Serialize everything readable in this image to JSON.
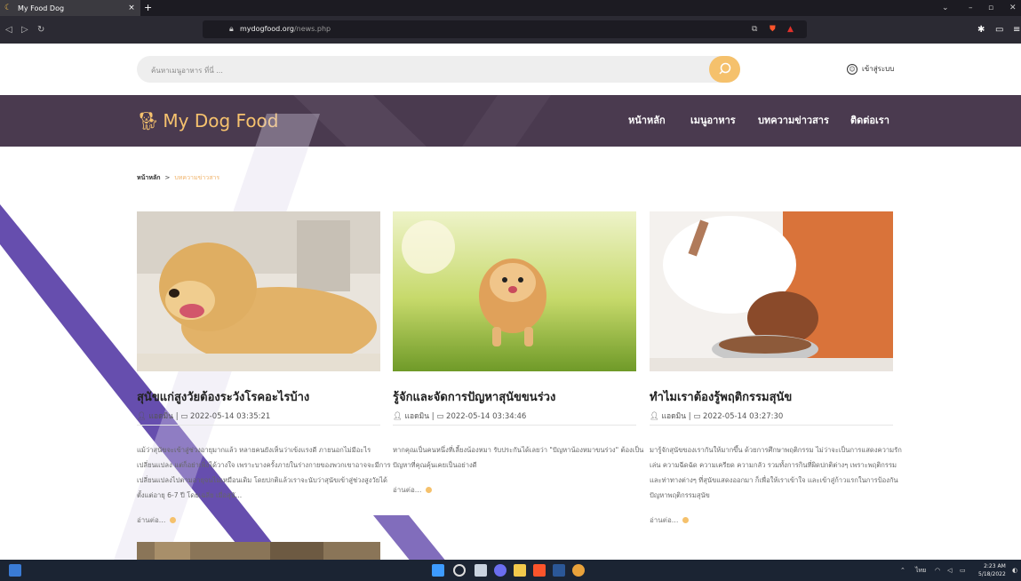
{
  "browser": {
    "tab_title": "My Food Dog",
    "tab_close": "×",
    "new_tab": "+",
    "url_domain": "mydogfood.org",
    "url_path": "/news.php"
  },
  "site": {
    "search_placeholder": "ค้นหาเมนูอาหาร ที่นี่ ...",
    "login_label": "เข้าสู่ระบบ",
    "logo_text": "My Dog Food",
    "nav": [
      "หน้าหลัก",
      "เมนูอาหาร",
      "บทความข่าวสาร",
      "ติดต่อเรา"
    ],
    "breadcrumb": {
      "home": "หน้าหลัก",
      "sep": ">",
      "current": "บทความข่าวสาร"
    },
    "read_more": "อ่านต่อ...",
    "articles": [
      {
        "title": "สุนัขแก่สูงวัยต้องระวังโรคอะไรบ้าง",
        "author": "แอดมิน",
        "date": "2022-05-14 03:35:21",
        "excerpt": "แม้ว่าสุนัขจะเข้าสู่ช่วงอายุมากแล้ว หลายคนยังเห็นว่าเข้งแรงดี ภายนอกไม่มีอะไรเปลี่ยนแปลง แต่ก็อย่าเพิ่งได้วางใจ เพราะบางครั้งภายในร่างกายของพวกเขาอาจจะมีการเปลี่ยนแปลงไปตามอายุจนไม่เหมือนเดิม โดยปกติแล้วเราจะนับว่าสุนัขเข้าสู่ช่วงสูงวัยได้ตั้งแต่อายุ 6-7 ปี โดยเฉลี่ย เมื่อสุนั..."
      },
      {
        "title": "รู้จักและจัดการปัญหาสุนัขขนร่วง",
        "author": "แอดมิน",
        "date": "2022-05-14 03:34:46",
        "excerpt": "หากคุณเป็นคนหนึ่งที่เลี้ยงน้องหมา รับประกันได้เลยว่า \"ปัญหาน้องหมาขนร่วง\" ต้องเป็นปัญหาที่คุณคุ้นเคยเป็นอย่างดี"
      },
      {
        "title": "ทำไมเราต้องรู้พฤติกรรมสุนัข",
        "author": "แอดมิน",
        "date": "2022-05-14 03:27:30",
        "excerpt": "มารู้จักสุนัขของเรากันให้มากขึ้น ด้วยการศึกษาพฤติกรรม ไม่ว่าจะเป็นการแสดงความรัก เล่น ความฉีดฉัด ความเครียด ความกลัว รวมทั้งการกินที่ผิดปกติต่างๆ เพราะพฤติกรรมและท่าทางต่างๆ ที่สุนัขแสดงออกมา ก็เพื่อให้เราเข้าใจ และเข้าสู่ก้าวแรกในการป้องกันปัญหาพฤติกรรมสุนัข"
      }
    ]
  },
  "taskbar": {
    "lang": "ไทย",
    "time": "2:23 AM",
    "date": "5/18/2022"
  },
  "colors": {
    "accent": "#f5c16c",
    "header": "#4a3a4f",
    "sweep": "#4b2fa0"
  }
}
